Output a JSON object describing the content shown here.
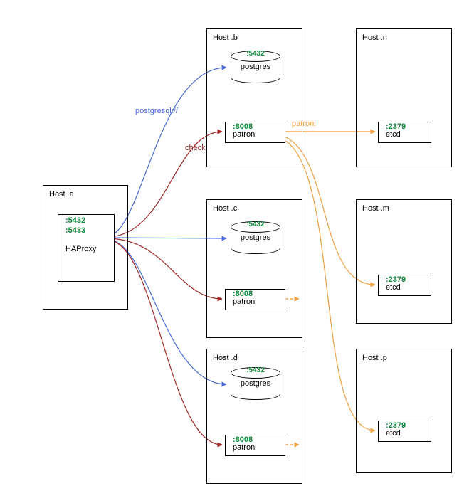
{
  "hosts": {
    "a": {
      "title": "Host  .a"
    },
    "b": {
      "title": "Host  .b"
    },
    "c": {
      "title": "Host  .c"
    },
    "d": {
      "title": "Host  .d"
    },
    "n": {
      "title": "Host  .n"
    },
    "m": {
      "title": "Host  .m"
    },
    "p": {
      "title": "Host  .p"
    }
  },
  "haproxy": {
    "port1": ":5432",
    "port2": ":5433",
    "label": "HAProxy"
  },
  "postgres": {
    "port": ":5432",
    "label": "postgres"
  },
  "patroni": {
    "port": ":8008",
    "label": "patroni"
  },
  "etcd": {
    "port": ":2379",
    "label": "etcd"
  },
  "edge_labels": {
    "pg": "postgresql://",
    "check": "check",
    "patroni": "patroni"
  },
  "colors": {
    "blue": "#4a6bd6",
    "red": "#a02828",
    "orange": "#f0a040"
  },
  "chart_data": {
    "type": "diagram",
    "nodes": [
      {
        "id": "host.a",
        "type": "host",
        "components": [
          {
            "name": "HAProxy",
            "ports": [
              5432,
              5433
            ]
          }
        ]
      },
      {
        "id": "host.b",
        "type": "host",
        "components": [
          {
            "name": "postgres",
            "ports": [
              5432
            ]
          },
          {
            "name": "patroni",
            "ports": [
              8008
            ]
          }
        ]
      },
      {
        "id": "host.c",
        "type": "host",
        "components": [
          {
            "name": "postgres",
            "ports": [
              5432
            ]
          },
          {
            "name": "patroni",
            "ports": [
              8008
            ]
          }
        ]
      },
      {
        "id": "host.d",
        "type": "host",
        "components": [
          {
            "name": "postgres",
            "ports": [
              5432
            ]
          },
          {
            "name": "patroni",
            "ports": [
              8008
            ]
          }
        ]
      },
      {
        "id": "host.n",
        "type": "host",
        "components": [
          {
            "name": "etcd",
            "ports": [
              2379
            ]
          }
        ]
      },
      {
        "id": "host.m",
        "type": "host",
        "components": [
          {
            "name": "etcd",
            "ports": [
              2379
            ]
          }
        ]
      },
      {
        "id": "host.p",
        "type": "host",
        "components": [
          {
            "name": "etcd",
            "ports": [
              2379
            ]
          }
        ]
      }
    ],
    "edges": [
      {
        "from": "host.a/HAProxy",
        "to": "host.b/postgres",
        "label": "postgresql://",
        "color": "blue"
      },
      {
        "from": "host.a/HAProxy",
        "to": "host.c/postgres",
        "label": "postgresql://",
        "color": "blue"
      },
      {
        "from": "host.a/HAProxy",
        "to": "host.d/postgres",
        "label": "postgresql://",
        "color": "blue"
      },
      {
        "from": "host.a/HAProxy",
        "to": "host.b/patroni",
        "label": "check",
        "color": "red"
      },
      {
        "from": "host.a/HAProxy",
        "to": "host.c/patroni",
        "label": "check",
        "color": "red"
      },
      {
        "from": "host.a/HAProxy",
        "to": "host.d/patroni",
        "label": "check",
        "color": "red"
      },
      {
        "from": "host.b/patroni",
        "to": "host.n/etcd",
        "label": "patroni",
        "color": "orange"
      },
      {
        "from": "host.b/patroni",
        "to": "host.m/etcd",
        "label": "patroni",
        "color": "orange"
      },
      {
        "from": "host.b/patroni",
        "to": "host.p/etcd",
        "label": "patroni",
        "color": "orange"
      },
      {
        "from": "host.c/patroni",
        "to": "etcd-cluster",
        "color": "orange"
      },
      {
        "from": "host.d/patroni",
        "to": "etcd-cluster",
        "color": "orange"
      }
    ]
  }
}
